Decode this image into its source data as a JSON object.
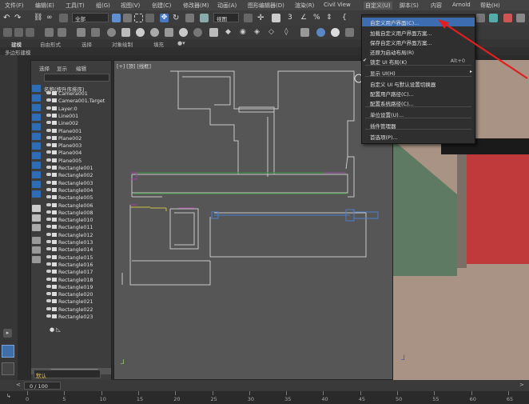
{
  "menubar": {
    "items": [
      "文件(F)",
      "编辑(E)",
      "工具(T)",
      "组(G)",
      "视图(V)",
      "创建(C)",
      "修改器(M)",
      "动画(A)",
      "图形编辑器(D)",
      "渲染(R)",
      "Civil View",
      "自定义(U)",
      "脚本(S)",
      "内容",
      "Arnold",
      "帮助(H)"
    ]
  },
  "toolbar": {
    "selection_set": "全部",
    "view_dropdown": "视图"
  },
  "ribbon": {
    "tabs": [
      "建模",
      "自由形式",
      "选择",
      "对象绘制",
      "填充"
    ],
    "panel_label": "多边形建模"
  },
  "scene_explorer": {
    "tabs": [
      "选择",
      "显示",
      "编辑"
    ],
    "sort_header": "名称(按升序排序)",
    "items": [
      "Camera001",
      "Camera001.Target",
      "Layer:0",
      "Line001",
      "Line002",
      "Plane001",
      "Plane002",
      "Plane003",
      "Plane004",
      "Plane005",
      "Rectangle001",
      "Rectangle002",
      "Rectangle003",
      "Rectangle004",
      "Rectangle005",
      "Rectangle006",
      "Rectangle008",
      "Rectangle010",
      "Rectangle011",
      "Rectangle012",
      "Rectangle013",
      "Rectangle014",
      "Rectangle015",
      "Rectangle016",
      "Rectangle017",
      "Rectangle018",
      "Rectangle019",
      "Rectangle020",
      "Rectangle021",
      "Rectangle022",
      "Rectangle023"
    ],
    "default_label": "默认"
  },
  "viewport_top": {
    "label": "[+] [顶] [线框]"
  },
  "customize_menu": {
    "items": [
      {
        "label": "自定义用户界面(C)...",
        "shortcut": "",
        "highlighted": true
      },
      {
        "label": "加载自定义用户界面方案...",
        "shortcut": ""
      },
      {
        "label": "保存自定义用户界面方案...",
        "shortcut": ""
      },
      {
        "label": "还原为启动布局(R)",
        "shortcut": ""
      },
      {
        "label": "锁定 UI 布局(K)",
        "shortcut": "Alt+0",
        "checked": true
      },
      {
        "label": "显示 UI(H)",
        "shortcut": "",
        "submenu": true
      },
      {
        "label": "自定义 UI 与默认设置切换器",
        "shortcut": ""
      },
      {
        "label": "配置用户路径(C)...",
        "shortcut": ""
      },
      {
        "label": "配置系统路径(C)...",
        "shortcut": ""
      },
      {
        "label": "单位设置(U)...",
        "shortcut": ""
      },
      {
        "label": "插件管理器",
        "shortcut": ""
      },
      {
        "label": "首选项(P)...",
        "shortcut": ""
      }
    ]
  },
  "timeline": {
    "frame_display": "0 / 100",
    "ticks": [
      "0",
      "5",
      "10",
      "15",
      "20",
      "25",
      "30",
      "35",
      "40",
      "45",
      "50",
      "55",
      "60",
      "65"
    ]
  },
  "colors": {
    "menu_highlight": "#3d6cb0",
    "annotation_arrow": "#e02020",
    "wall_green": "#5f7a62",
    "wall_red": "#c0393b"
  }
}
